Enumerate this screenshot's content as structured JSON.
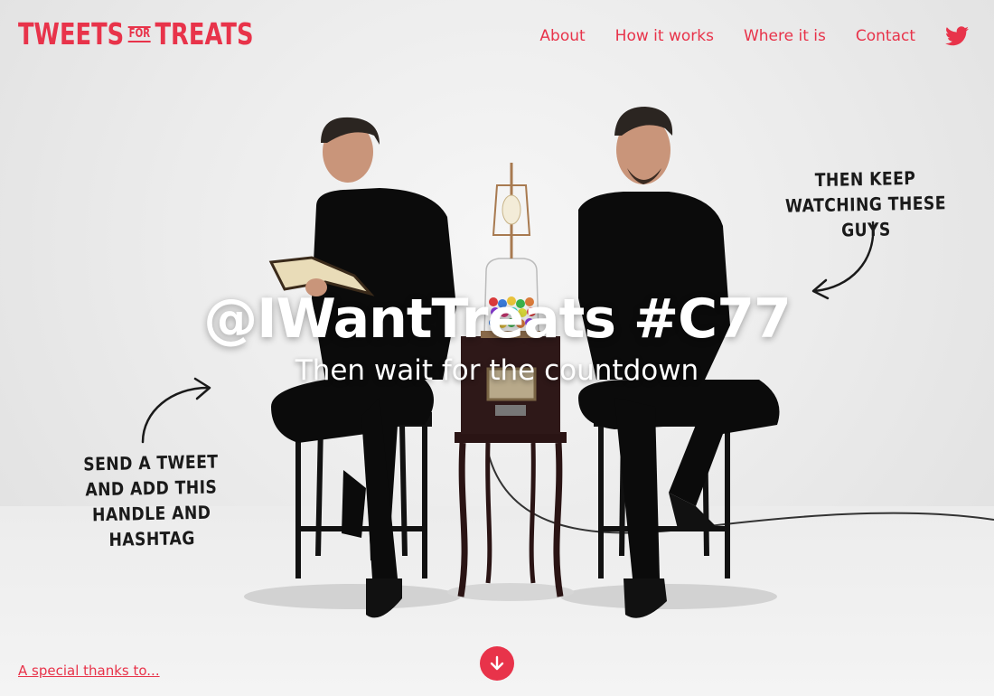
{
  "brand": {
    "logo_left": "TWEETS",
    "logo_mid": "FOR",
    "logo_right": "TREATS",
    "accent_color": "#e8334a"
  },
  "nav": {
    "items": [
      {
        "label": "About"
      },
      {
        "label": "How it works"
      },
      {
        "label": "Where it is"
      },
      {
        "label": "Contact"
      }
    ],
    "social_icon": "twitter-icon"
  },
  "hero": {
    "headline": "@IWantTreats #C77",
    "subline": "Then wait for the countdown",
    "note_right": "Then keep watching these guys",
    "note_left": "Send a tweet and add this handle and hashtag"
  },
  "footer": {
    "thanks": "A special thanks to...",
    "scroll_icon": "arrow-down-icon"
  }
}
